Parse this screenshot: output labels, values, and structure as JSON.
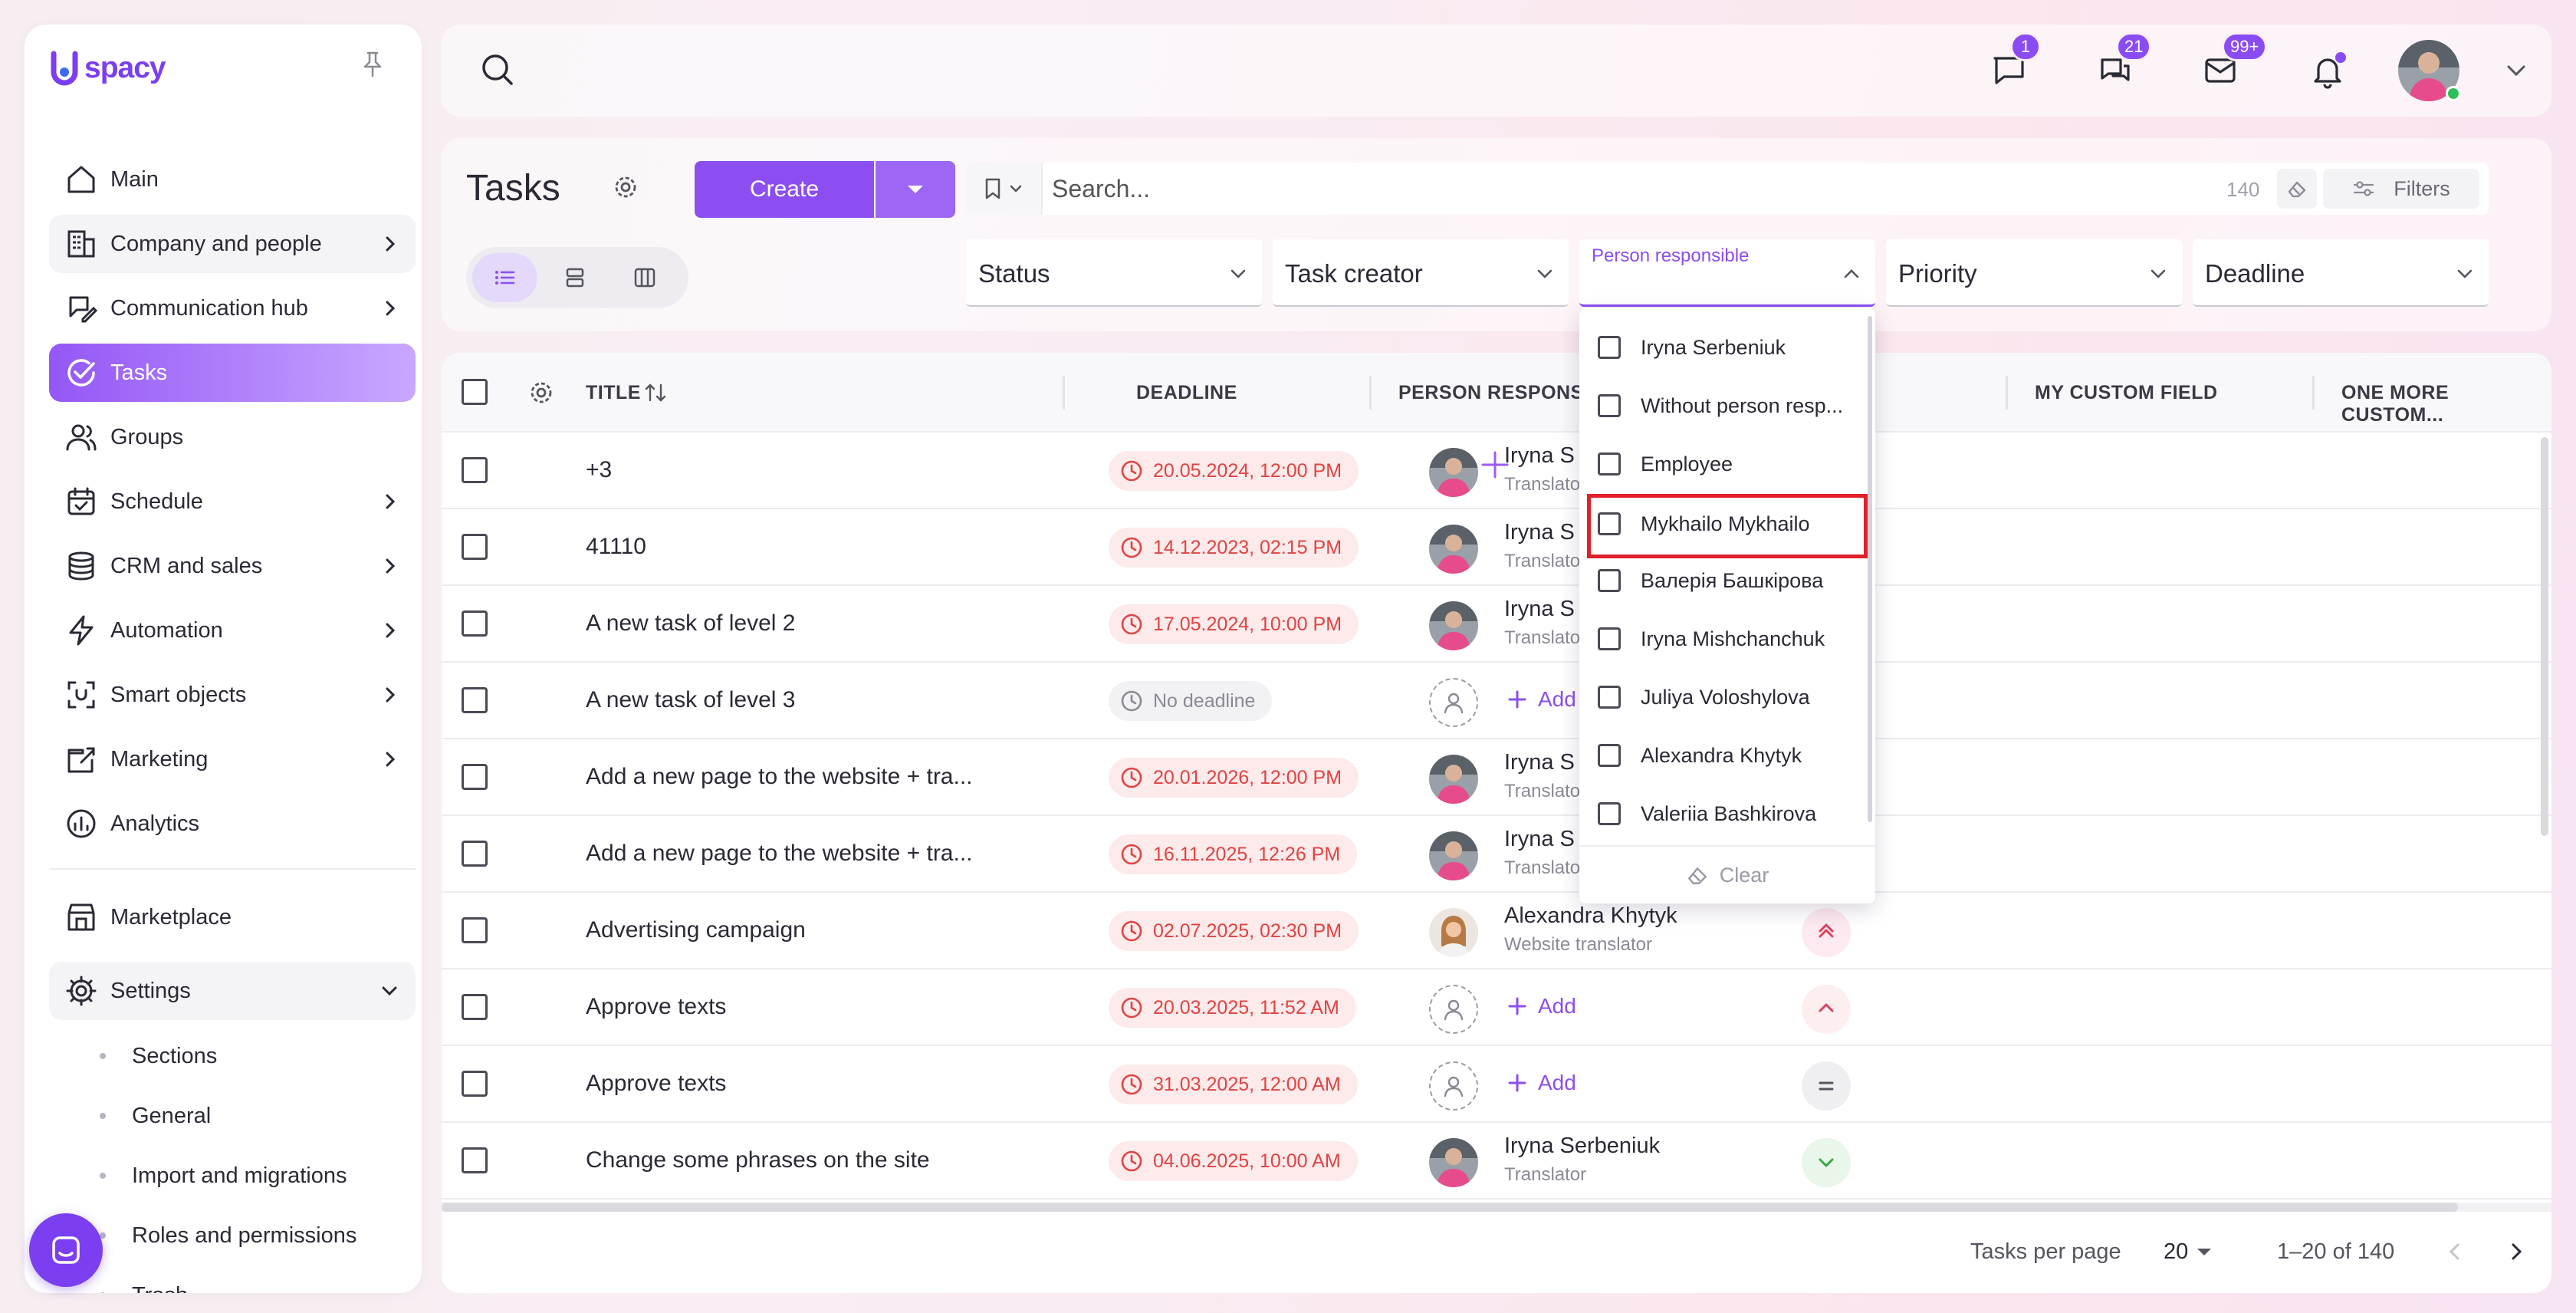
{
  "app": {
    "logo_text": "spacy"
  },
  "sidebar": {
    "items": [
      {
        "label": "Main",
        "icon": "home-icon"
      },
      {
        "label": "Company and people",
        "icon": "building-icon"
      },
      {
        "label": "Communication hub",
        "icon": "chat-edit-icon"
      },
      {
        "label": "Tasks",
        "icon": "check-circle-icon"
      },
      {
        "label": "Groups",
        "icon": "users-icon"
      },
      {
        "label": "Schedule",
        "icon": "calendar-icon"
      },
      {
        "label": "CRM and sales",
        "icon": "database-icon"
      },
      {
        "label": "Automation",
        "icon": "lightning-icon"
      },
      {
        "label": "Smart objects",
        "icon": "smart-object-icon"
      },
      {
        "label": "Marketing",
        "icon": "marketing-icon"
      },
      {
        "label": "Analytics",
        "icon": "analytics-icon"
      }
    ],
    "marketplace": "Marketplace",
    "settings": "Settings",
    "settings_sub": [
      "Sections",
      "General",
      "Import and migrations",
      "Roles and permissions",
      "Trash"
    ]
  },
  "topbar": {
    "badges": {
      "chat": "1",
      "messages": "21",
      "mail": "99+"
    }
  },
  "header": {
    "title": "Tasks",
    "create_label": "Create",
    "search_placeholder": "Search...",
    "search_count": "140",
    "filters_label": "Filters",
    "filters": [
      "Status",
      "Task creator",
      "Person responsible",
      "Priority",
      "Deadline"
    ]
  },
  "table": {
    "columns": [
      "TITLE",
      "DEADLINE",
      "PERSON RESPONSIBLE",
      "MY CUSTOM FIELD",
      "ONE MORE CUSTOM..."
    ],
    "rows": [
      {
        "title": "+3",
        "deadline": "20.05.2024, 12:00 PM",
        "resp": "Iryna S",
        "role": "Translator",
        "prio": ""
      },
      {
        "title": "41110",
        "deadline": "14.12.2023, 02:15 PM",
        "resp": "Iryna S",
        "role": "Translator",
        "prio": ""
      },
      {
        "title": "A new task of level 2",
        "deadline": "17.05.2024, 10:00 PM",
        "resp": "Iryna S",
        "role": "Translator",
        "prio": ""
      },
      {
        "title": "A new task of level 3",
        "deadline": "No deadline",
        "resp": "",
        "role": "",
        "prio": ""
      },
      {
        "title": "Add a new page to the website + tra...",
        "deadline": "20.01.2026, 12:00 PM",
        "resp": "Iryna S",
        "role": "Translator",
        "prio": ""
      },
      {
        "title": "Add a new page to the website + tra...",
        "deadline": "16.11.2025, 12:26 PM",
        "resp": "Iryna S",
        "role": "Translator",
        "prio": ""
      },
      {
        "title": "Advertising campaign",
        "deadline": "02.07.2025, 02:30 PM",
        "resp": "Alexandra Khytyk",
        "role": "Website translator",
        "prio": "highest"
      },
      {
        "title": "Approve texts",
        "deadline": "20.03.2025, 11:52 AM",
        "resp": "",
        "role": "",
        "prio": "high"
      },
      {
        "title": "Approve texts",
        "deadline": "31.03.2025, 12:00 AM",
        "resp": "",
        "role": "",
        "prio": "normal"
      },
      {
        "title": "Change some phrases on the site",
        "deadline": "04.06.2025, 10:00 AM",
        "resp": "Iryna Serbeniuk",
        "role": "Translator",
        "prio": "low"
      }
    ],
    "add_label": "Add"
  },
  "dropdown": {
    "options": [
      "Iryna Serbeniuk",
      "Without person resp...",
      "Employee",
      "Mykhailo Mykhailo",
      "Валерія Башкірова",
      "Iryna Mishchanchuk",
      "Juliya Voloshylova",
      "Alexandra Khytyk",
      "Valeriia Bashkirova"
    ],
    "clear_label": "Clear"
  },
  "footer": {
    "per_page_label": "Tasks per page",
    "per_page_value": "20",
    "range": "1–20 of 140"
  },
  "colors": {
    "accent": "#8c4ef0",
    "deadline_red": "#e04343",
    "highlight": "#e0202a"
  }
}
